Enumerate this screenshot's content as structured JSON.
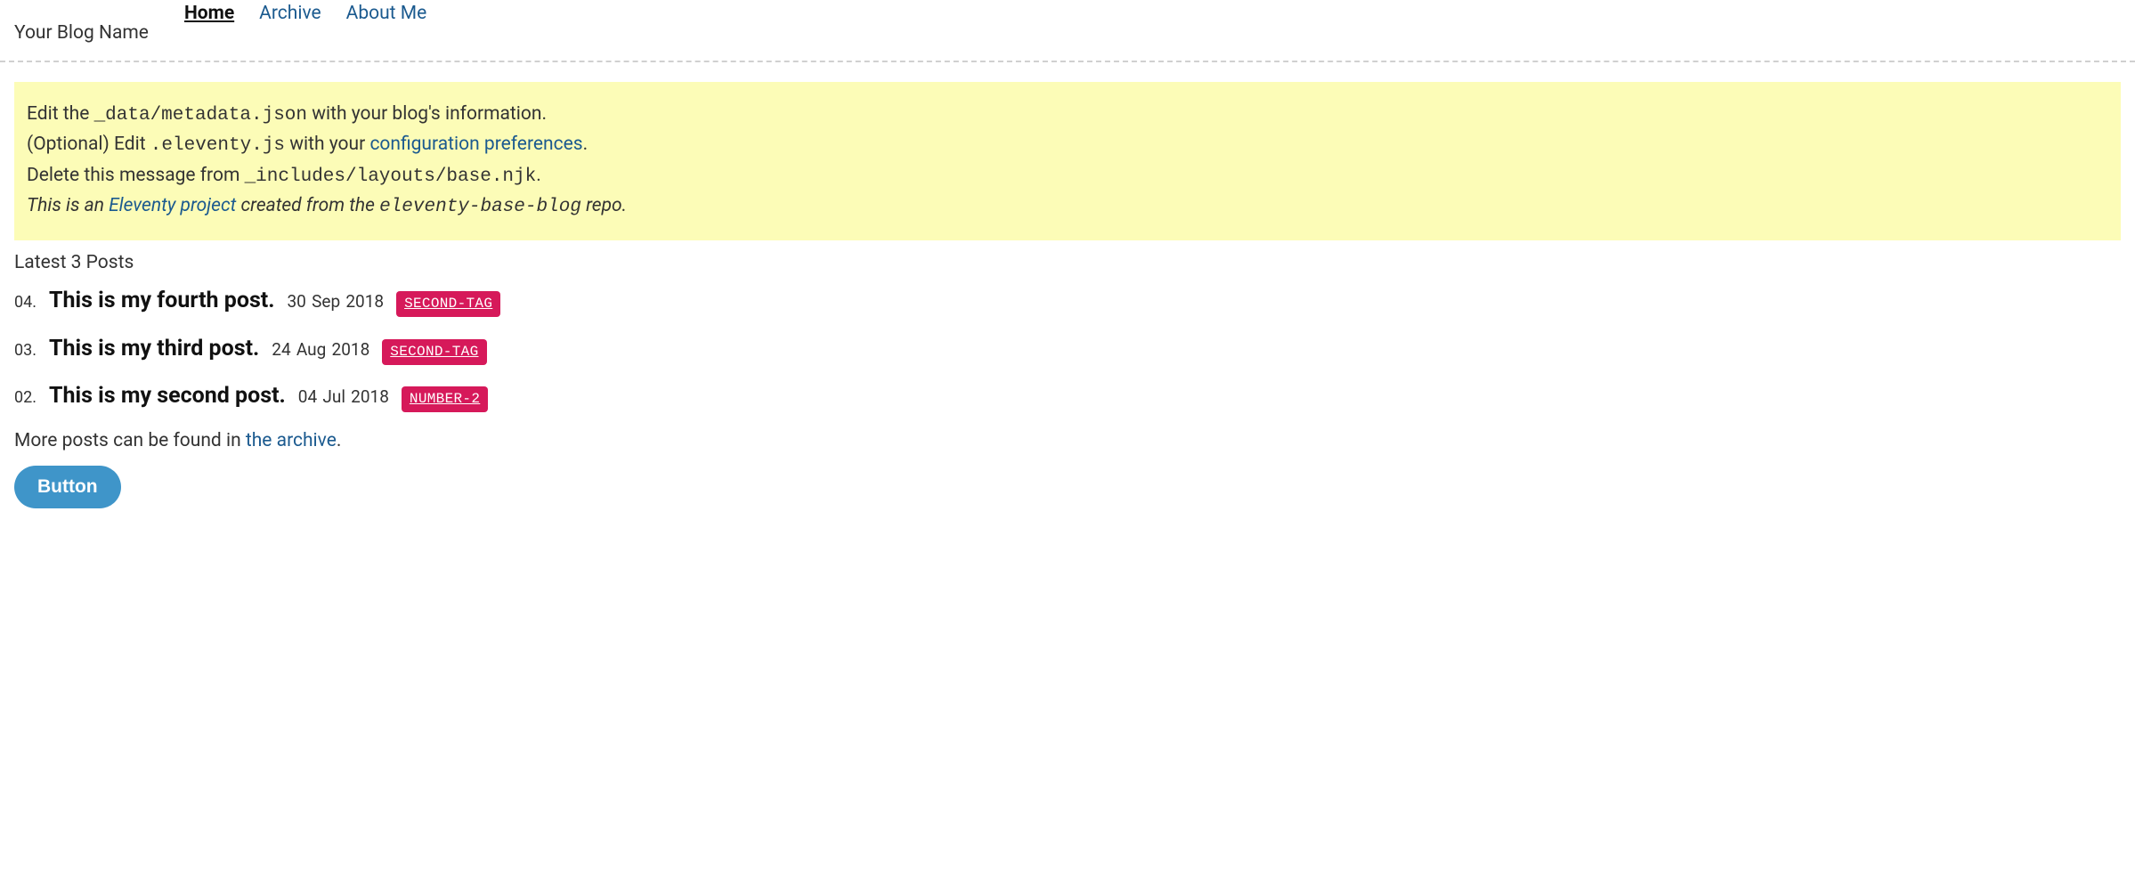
{
  "header": {
    "site_title": "Your Blog Name",
    "nav": [
      {
        "label": "Home",
        "active": true
      },
      {
        "label": "Archive",
        "active": false
      },
      {
        "label": "About Me",
        "active": false
      }
    ]
  },
  "warning": {
    "line1_a": "Edit the ",
    "line1_code": "_data/metadata.json",
    "line1_b": " with your blog's information.",
    "line2_a": "(Optional) Edit ",
    "line2_code": ".eleventy.js",
    "line2_b": " with your ",
    "line2_link": "configuration preferences",
    "line2_c": ".",
    "line3_a": "Delete this message from ",
    "line3_code": "_includes/layouts/base.njk",
    "line3_b": ".",
    "line4_a": "This is an ",
    "line4_link": "Eleventy project",
    "line4_b": " created from the ",
    "line4_code": "eleventy-base-blog",
    "line4_c": " repo."
  },
  "section_heading": "Latest 3 Posts",
  "posts": [
    {
      "num": "04.",
      "title": "This is my fourth post.",
      "date": "30 Sep 2018",
      "tag": "SECOND-TAG"
    },
    {
      "num": "03.",
      "title": "This is my third post.",
      "date": "24 Aug 2018",
      "tag": "SECOND-TAG"
    },
    {
      "num": "02.",
      "title": "This is my second post.",
      "date": "04 Jul 2018",
      "tag": "NUMBER-2"
    }
  ],
  "more_posts": {
    "prefix": "More posts can be found in ",
    "link": "the archive",
    "suffix": "."
  },
  "button_label": "Button"
}
